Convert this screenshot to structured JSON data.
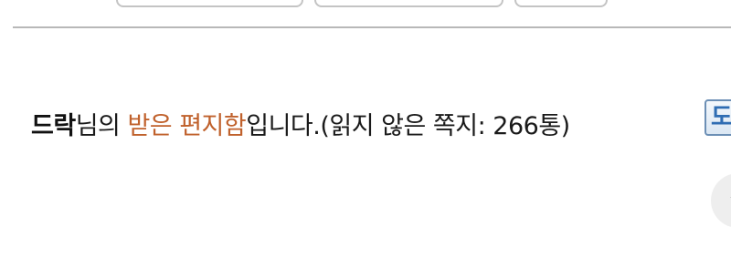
{
  "header": {
    "buttons": [
      "",
      "",
      ""
    ]
  },
  "mailbox": {
    "username": "드락",
    "suffix_nim": "님의 ",
    "box_link_label": "받은 편지함",
    "text_after_box": "입니다.",
    "unread_label": "(읽지 않은 쪽지: ",
    "unread_count": "266",
    "unread_unit": "통)"
  },
  "side_icon": {
    "icon": "inbox-icon",
    "glyph": "도",
    "color": "#2f6db3"
  },
  "scroll_button": {
    "icon": "arrow-up-icon",
    "glyph": "↑"
  },
  "colors": {
    "link": "#c0612c",
    "divider": "#b8b8b8"
  }
}
